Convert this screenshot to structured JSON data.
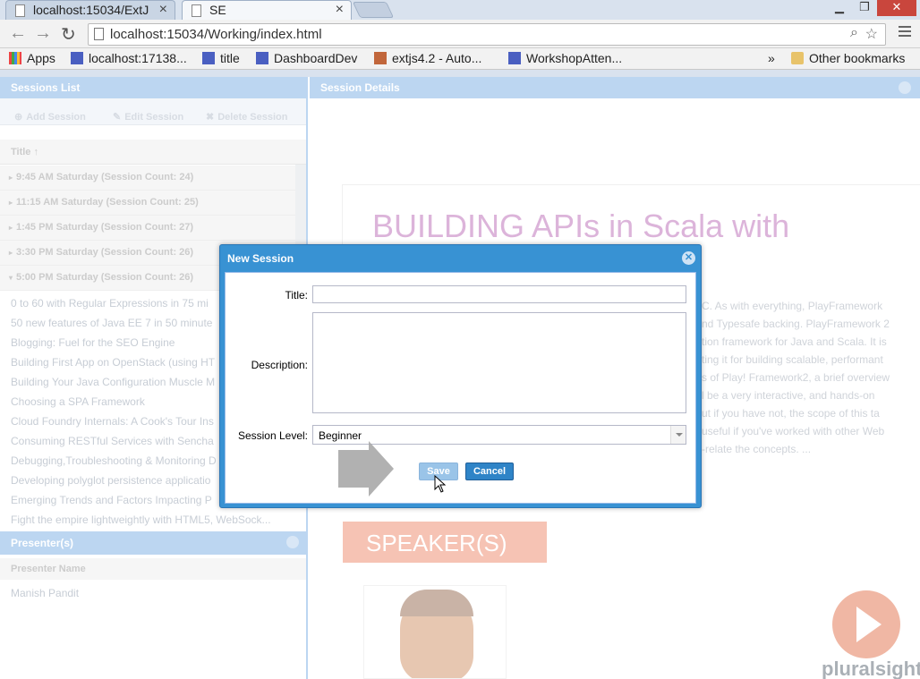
{
  "browser": {
    "tabs": [
      {
        "title": "localhost:15034/ExtJ",
        "active": false
      },
      {
        "title": "SE",
        "active": true
      }
    ],
    "url": "localhost:15034/Working/index.html",
    "bookmarks": [
      "Apps",
      "localhost:17138...",
      "title",
      "DashboardDev",
      "extjs4.2 - Auto...",
      "WorkshopAtten..."
    ],
    "more": "»",
    "other_bookmarks": "Other bookmarks"
  },
  "sessions_list": {
    "title": "Sessions List",
    "toolbar": {
      "add": "Add Session",
      "edit": "Edit Session",
      "delete": "Delete Session"
    },
    "column": "Title ↑",
    "groups": [
      "9:45 AM Saturday (Session Count: 24)",
      "11:15 AM Saturday (Session Count: 25)",
      "1:45 PM Saturday (Session Count: 27)",
      "3:30 PM Saturday (Session Count: 26)",
      "5:00 PM Saturday (Session Count: 26)"
    ],
    "rows": [
      "0 to 60 with Regular Expressions in 75 mi",
      "50 new features of Java EE 7 in 50 minute",
      "Blogging: Fuel for the SEO Engine",
      "Building First App on OpenStack (using HT",
      "Building Your Java Configuration Muscle M",
      "Choosing a SPA Framework",
      "Cloud Foundry Internals: A Cook's Tour Ins",
      "Consuming RESTful Services with Sencha",
      "Debugging,Troubleshooting & Monitoring D",
      "Developing polyglot persistence applicatio",
      "Emerging Trends and Factors Impacting P",
      "Fight the empire lightweightly with HTML5, WebSock..."
    ]
  },
  "presenters": {
    "title": "Presenter(s)",
    "column": "Presenter Name",
    "rows": [
      "Manish Pandit"
    ]
  },
  "session_details": {
    "title": "Session Details",
    "heading": "BUILDING APIs in Scala with",
    "description_lines": [
      "C. As with everything, PlayFramework",
      "nd Typesafe backing. PlayFramework 2",
      "tion framework for Java and Scala. It is",
      "ting it for building scalable, performant",
      "s of Play! Framework2, a brief overview",
      "l be a very interactive, and hands-on",
      "ut if you have not, the scope of this ta",
      "useful if you've worked with other Web",
      "-relate the concepts. ..."
    ],
    "speaker_heading": "SPEAKER(S)"
  },
  "dialog": {
    "title": "New Session",
    "title_label": "Title:",
    "title_value": "",
    "description_label": "Description:",
    "description_value": "",
    "level_label": "Session Level:",
    "level_value": "Beginner",
    "save": "Save",
    "cancel": "Cancel"
  },
  "watermark": "pluralsight"
}
